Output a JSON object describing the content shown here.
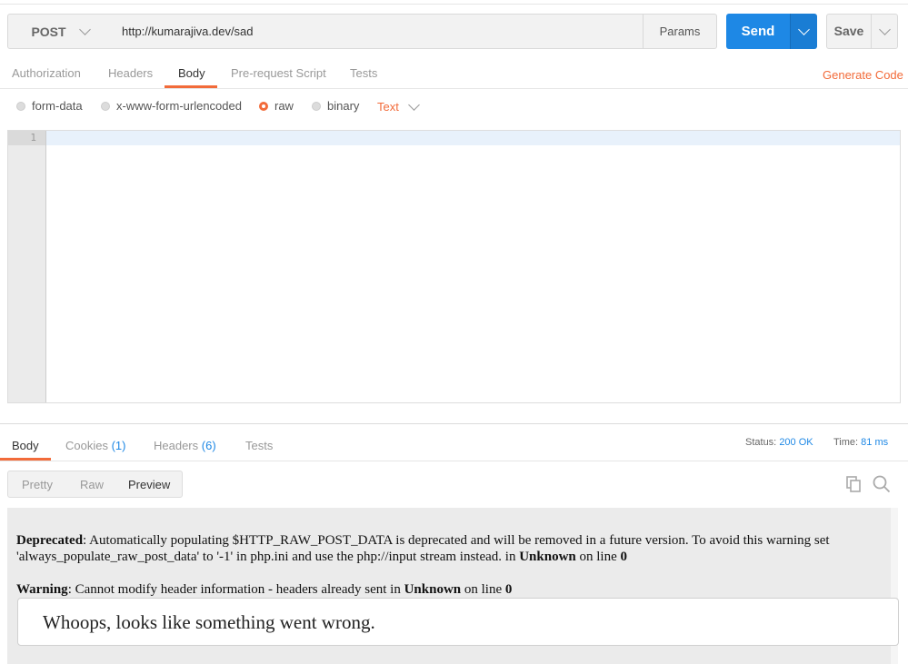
{
  "request": {
    "method": "POST",
    "url": "http://kumarajiva.dev/sad",
    "params_label": "Params",
    "send_label": "Send",
    "save_label": "Save"
  },
  "request_tabs": {
    "authorization": "Authorization",
    "headers": "Headers",
    "body": "Body",
    "pre_request": "Pre-request Script",
    "tests": "Tests",
    "active": "Body"
  },
  "generate_code_label": "Generate Code",
  "body_types": {
    "form_data": "form-data",
    "urlencoded": "x-www-form-urlencoded",
    "raw": "raw",
    "binary": "binary",
    "selected": "raw",
    "raw_format": "Text"
  },
  "editor": {
    "line_numbers": [
      "1"
    ],
    "content": ""
  },
  "response_tabs": {
    "body": "Body",
    "cookies": "Cookies",
    "cookies_count": "(1)",
    "headers": "Headers",
    "headers_count": "(6)",
    "tests": "Tests",
    "active": "Body"
  },
  "response_status": {
    "status_label": "Status:",
    "status_value": "200 OK",
    "time_label": "Time:",
    "time_value": "81 ms"
  },
  "view_modes": {
    "pretty": "Pretty",
    "raw": "Raw",
    "preview": "Preview",
    "active": "Preview"
  },
  "icons": {
    "copy": "copy-icon",
    "search": "search-icon",
    "method_dropdown": "chevron-down-icon"
  },
  "colors": {
    "accent": "#f26b3a",
    "send": "#1e88e5",
    "link": "#1e88e5"
  },
  "preview": {
    "deprecated_label": "Deprecated",
    "deprecated_text": ": Automatically populating $HTTP_RAW_POST_DATA is deprecated and will be removed in a future version. To avoid this warning set 'always_populate_raw_post_data' to '-1' in php.ini and use the php://input stream instead. in ",
    "deprecated_where": "Unknown",
    "deprecated_online": " on line ",
    "deprecated_line": "0",
    "warning_label": "Warning",
    "warning_text": ": Cannot modify header information - headers already sent in ",
    "warning_where": "Unknown",
    "warning_online": " on line ",
    "warning_line": "0",
    "whoops": "Whoops, looks like something went wrong."
  }
}
